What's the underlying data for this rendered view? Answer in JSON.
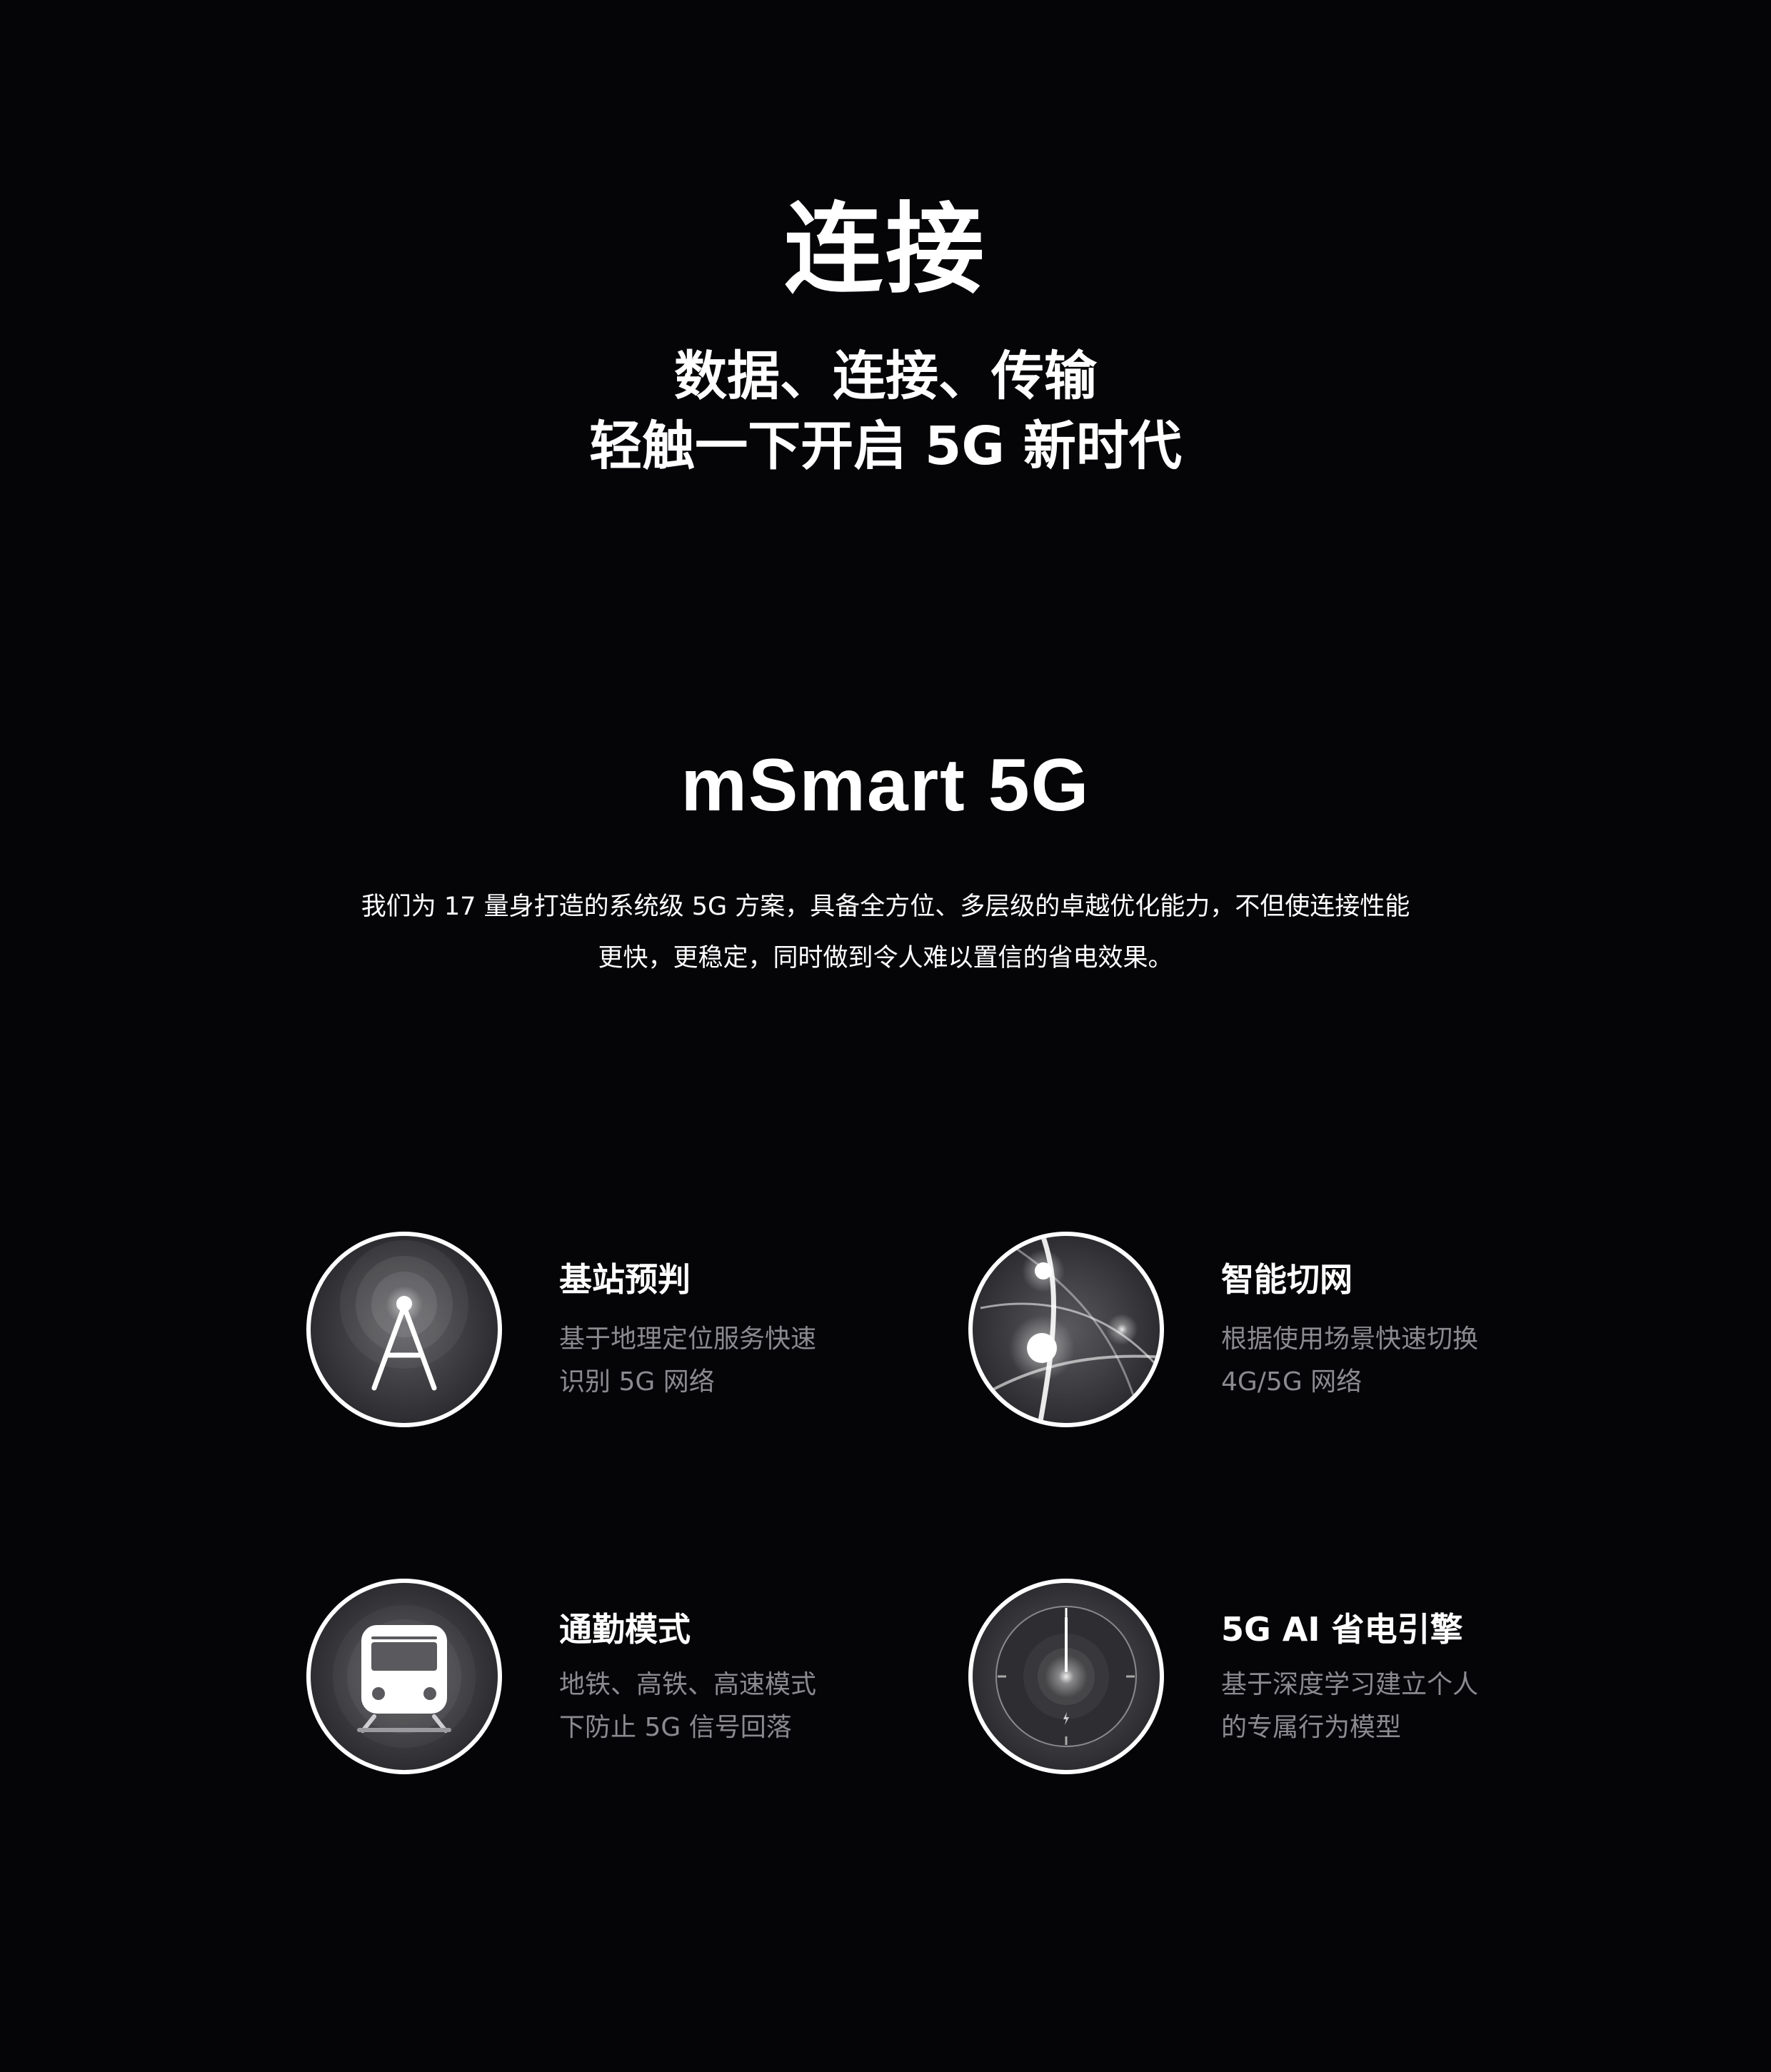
{
  "hero": {
    "title": "连接",
    "subtitle_line1": "数据、连接、传输",
    "subtitle_line2": "轻触一下开启 5G 新时代"
  },
  "section": {
    "title": "mSmart 5G",
    "desc_line1": "我们为 17 量身打造的系统级 5G 方案，具备全方位、多层级的卓越优化能力，不但使连接性能",
    "desc_line2": "更快，更稳定，同时做到令人难以置信的省电效果。"
  },
  "features": [
    {
      "title": "基站预判",
      "desc_line1": "基于地理定位服务快速",
      "desc_line2": "识别 5G 网络",
      "icon": "cell-tower-icon"
    },
    {
      "title": "智能切网",
      "desc_line1": "根据使用场景快速切换",
      "desc_line2": "4G/5G 网络",
      "icon": "network-switch-icon"
    },
    {
      "title": "通勤模式",
      "desc_line1": "地铁、高铁、高速模式",
      "desc_line2": "下防止 5G 信号回落",
      "icon": "train-icon"
    },
    {
      "title": "5G AI 省电引擎",
      "desc_line1": "基于深度学习建立个人",
      "desc_line2": "的专属行为模型",
      "icon": "power-dial-icon"
    }
  ],
  "colors": {
    "background": "#050508",
    "heading": "#ffffff",
    "muted_text": "#8a8a8f",
    "icon_ring": "#ffffff",
    "icon_fill": "#3a3a3d"
  }
}
